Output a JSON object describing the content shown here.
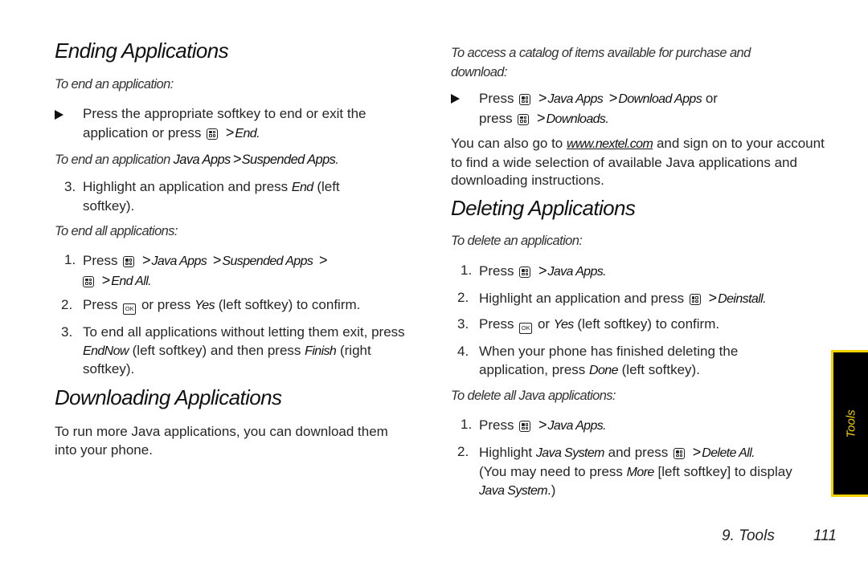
{
  "left": {
    "ending": {
      "heading": "Ending Applications",
      "sub1": "To end an application:",
      "bullet": {
        "text1": "Press the appropriate softkey to end or exit the application or press",
        "icon": "menu-key-icon",
        "sep": ">",
        "target": "End",
        "tail": "."
      },
      "sub2_prefix": "To end an application",
      "sub2_path1": "Java Apps",
      "sub2_sep": ">",
      "sub2_path2": "Suspended Apps",
      "sub2_tail": ".",
      "step3": {
        "num": "3.",
        "text1": "Highlight an application and press",
        "em": "End",
        "text2": "(left softkey)."
      },
      "sub3": "To end all applications:",
      "all_steps": [
        {
          "num": "1.",
          "text1": "Press",
          "p1": "Java Apps",
          "p2": "Suspended Apps",
          "p3": "End All",
          "sep": ">",
          "tail": "."
        },
        {
          "num": "2.",
          "text1": "Press",
          "ok_label": "OK",
          "text2": "or press",
          "em": "Yes",
          "text3": "(left softkey) to confirm."
        },
        {
          "num": "3.",
          "text1": "To end all applications without letting them exit, press",
          "em1": "EndNow",
          "text2": "(left softkey) and then press",
          "em2": "Finish",
          "text3": "(right softkey)."
        }
      ]
    },
    "downloading": {
      "heading": "Downloading Applications",
      "para": "To run more Java applications, you can download them into your phone."
    }
  },
  "right": {
    "catalog_sub": "To access a catalog of items available for purchase and download:",
    "catalog_bullet": {
      "text1": "Press",
      "p1": "Java Apps",
      "p2": "Download Apps",
      "or": "or",
      "text2": "press",
      "p3": "Downloads",
      "sep": ">",
      "tail": "."
    },
    "also": {
      "text1": "You can also go to",
      "link": "www.nextel.com",
      "text2": "and sign on to your account to find a wide selection of available Java applications and downloading instructions."
    },
    "deleting": {
      "heading": "Deleting Applications",
      "sub1": "To delete an application:",
      "steps": [
        {
          "num": "1.",
          "text1": "Press",
          "em": "Java Apps",
          "tail": "."
        },
        {
          "num": "2.",
          "text1": "Highlight an application and press",
          "em": "Deinstall",
          "tail": "."
        },
        {
          "num": "3.",
          "text1": "Press",
          "ok_label": "OK",
          "text2": "or",
          "em": "Yes",
          "text3": "(left softkey) to confirm."
        },
        {
          "num": "4.",
          "text1": "When your phone has finished deleting the application, press",
          "em": "Done",
          "text2": "(left softkey)."
        }
      ],
      "sub2": "To delete all Java applications:",
      "all_steps": [
        {
          "num": "1.",
          "text1": "Press",
          "em": "Java Apps",
          "tail": "."
        },
        {
          "num": "2.",
          "text1": "Highlight",
          "em1": "Java System",
          "text2": "and press",
          "em2": "Delete All",
          "tail": ".",
          "text3": "(You may need to press",
          "em3": "More",
          "text4": "[left softkey] to display",
          "em4": "Java System",
          "tail2": ".)"
        }
      ],
      "sep": ">"
    }
  },
  "side_tab": {
    "label": "Tools",
    "bg": "#000000",
    "accent": "#f2d100"
  },
  "footer": {
    "section": "9. Tools",
    "page": "111"
  }
}
